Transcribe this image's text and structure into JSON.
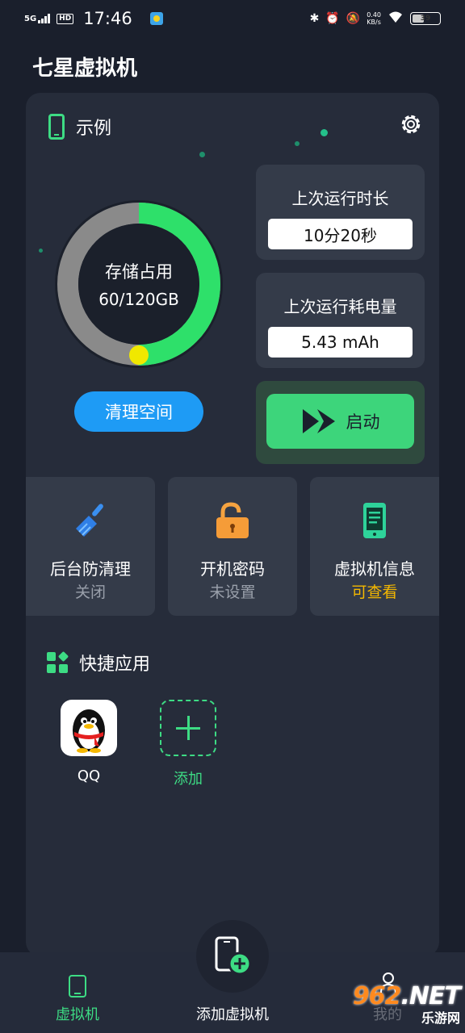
{
  "status_bar": {
    "network": "5G",
    "hd": "HD",
    "time": "17:46",
    "speed_value": "0.40",
    "speed_unit": "KB/s",
    "battery": "39"
  },
  "app_title": "七星虚拟机",
  "vm": {
    "name": "示例",
    "storage": {
      "title": "存储占用",
      "value_text": "60/120GB",
      "used_gb": 60,
      "total_gb": 120
    },
    "clean_button": "清理空间",
    "last_runtime": {
      "title": "上次运行时长",
      "value": "10分20秒"
    },
    "last_power": {
      "title": "上次运行耗电量",
      "value": "5.43  mAh"
    },
    "start_button": "启动"
  },
  "tiles": [
    {
      "label": "后台防清理",
      "status": "关闭",
      "icon": "broom-icon"
    },
    {
      "label": "开机密码",
      "status": "未设置",
      "icon": "unlocked-padlock-icon"
    },
    {
      "label": "虚拟机信息",
      "status": "可查看",
      "icon": "phone-info-icon"
    }
  ],
  "shortcuts": {
    "title": "快捷应用",
    "apps": [
      {
        "label": "QQ",
        "icon": "qq-penguin-icon"
      },
      {
        "label": "添加",
        "icon": "add-icon"
      }
    ]
  },
  "bottom_nav": {
    "items": [
      {
        "label": "虚拟机",
        "active": true
      },
      {
        "label": "添加虚拟机",
        "active": false
      },
      {
        "label": "我的",
        "active": false
      }
    ]
  },
  "watermark": {
    "main_digits": "962",
    "main_suffix": ".NET",
    "sub": "乐游网"
  },
  "colors": {
    "background": "#1a1f2c",
    "card": "#262c3a",
    "accent_green": "#3ddc84",
    "button_blue": "#1e9bf5",
    "highlight_yellow": "#f5b800"
  }
}
